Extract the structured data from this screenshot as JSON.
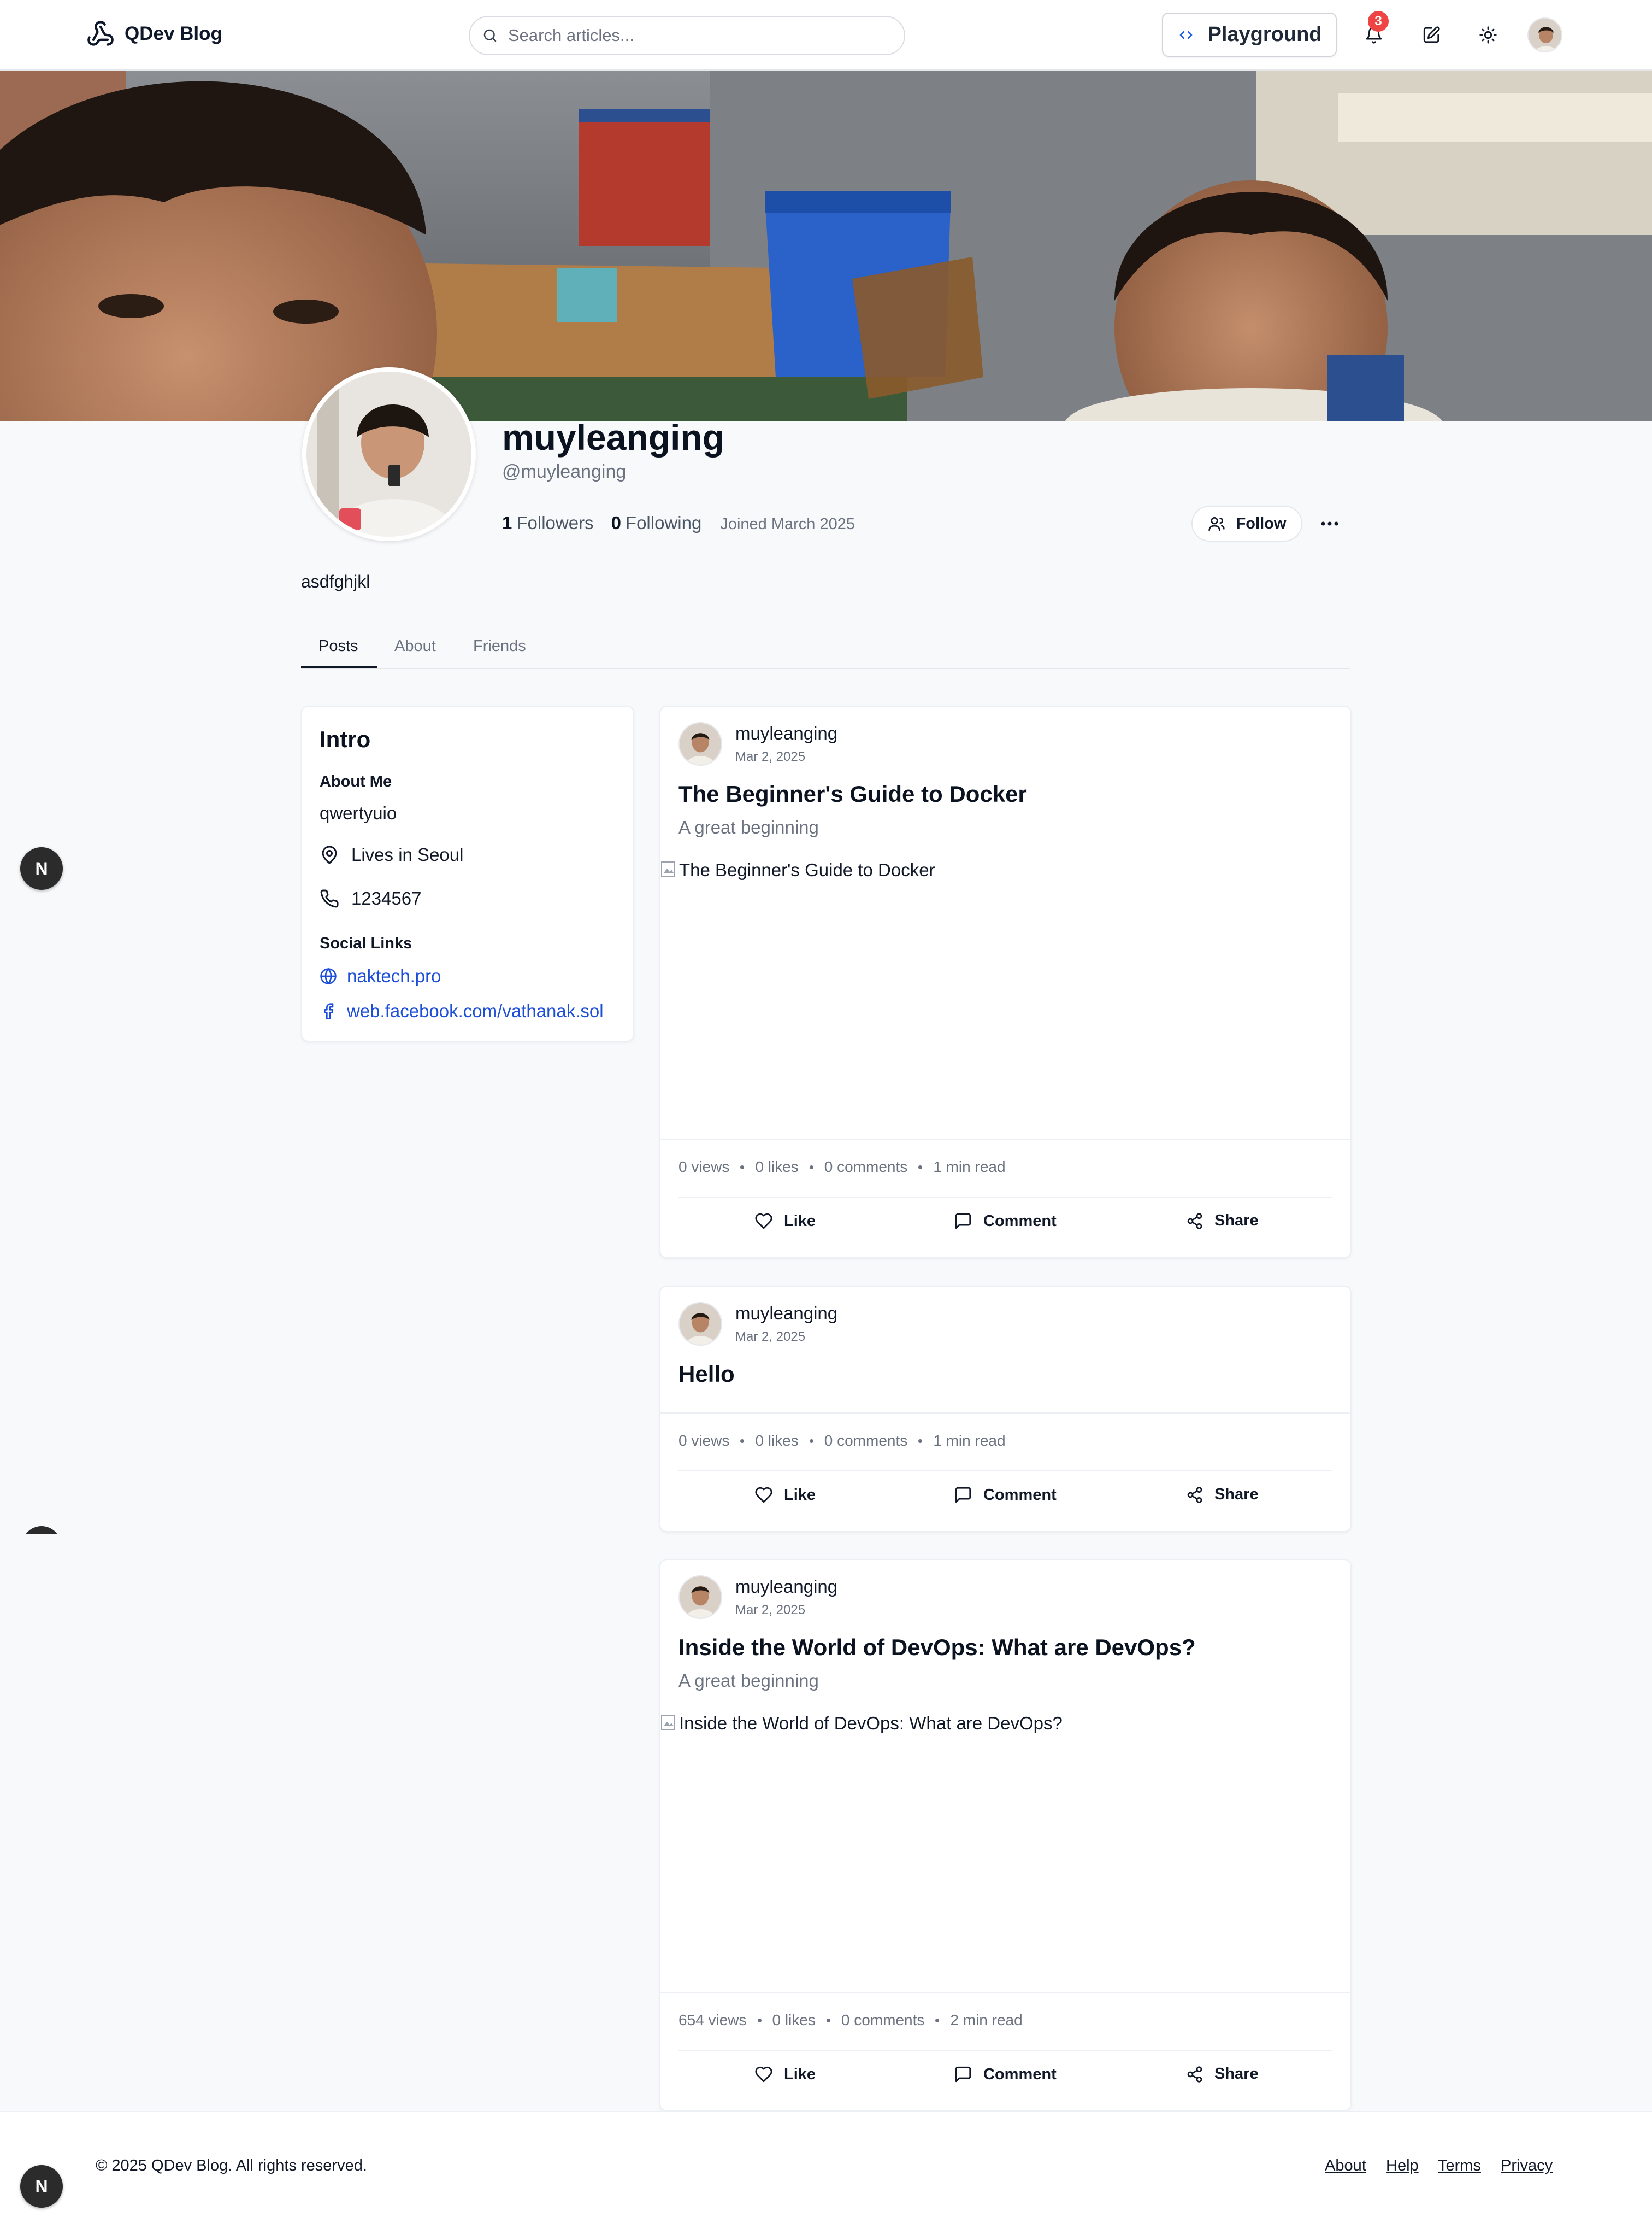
{
  "header": {
    "brand": "QDev Blog",
    "search_placeholder": "Search articles...",
    "playground_label": "Playground",
    "notification_count": "3"
  },
  "profile": {
    "name": "muyleanging",
    "handle": "@muyleanging",
    "followers_count": "1",
    "followers_label": "Followers",
    "following_count": "0",
    "following_label": "Following",
    "joined": "Joined March 2025",
    "follow_label": "Follow",
    "bio": "asdfghjkl"
  },
  "tabs": [
    {
      "label": "Posts",
      "active": true
    },
    {
      "label": "About",
      "active": false
    },
    {
      "label": "Friends",
      "active": false
    }
  ],
  "intro": {
    "title": "Intro",
    "about_heading": "About Me",
    "about_text": "qwertyuio",
    "location": "Lives in Seoul",
    "phone": "1234567",
    "social_heading": "Social Links",
    "links": [
      "naktech.pro",
      "web.facebook.com/vathanak.sol"
    ]
  },
  "posts": [
    {
      "author": "muyleanging",
      "date": "Mar 2, 2025",
      "title": "The Beginner's Guide to Docker",
      "subtitle": "A great beginning",
      "image_alt": "The Beginner's Guide to Docker",
      "views": "0 views",
      "likes": "0 likes",
      "comments": "0 comments",
      "read": "1 min read"
    },
    {
      "author": "muyleanging",
      "date": "Mar 2, 2025",
      "title": "Hello",
      "views": "0 views",
      "likes": "0 likes",
      "comments": "0 comments",
      "read": "1 min read"
    },
    {
      "author": "muyleanging",
      "date": "Mar 2, 2025",
      "title": "Inside the World of DevOps: What are DevOps?",
      "subtitle": "A great beginning",
      "image_alt": "Inside the World of DevOps: What are DevOps?",
      "views": "654 views",
      "likes": "0 likes",
      "comments": "0 comments",
      "read": "2 min read"
    }
  ],
  "actions": {
    "like": "Like",
    "comment": "Comment",
    "share": "Share"
  },
  "badge_letter": "N",
  "footer": {
    "copyright": "© 2025 QDev Blog. All rights reserved.",
    "links": [
      "About",
      "Help",
      "Terms",
      "Privacy"
    ]
  },
  "colors": {
    "accent_link": "#1d4ed8",
    "badge_red": "#ef4444"
  }
}
